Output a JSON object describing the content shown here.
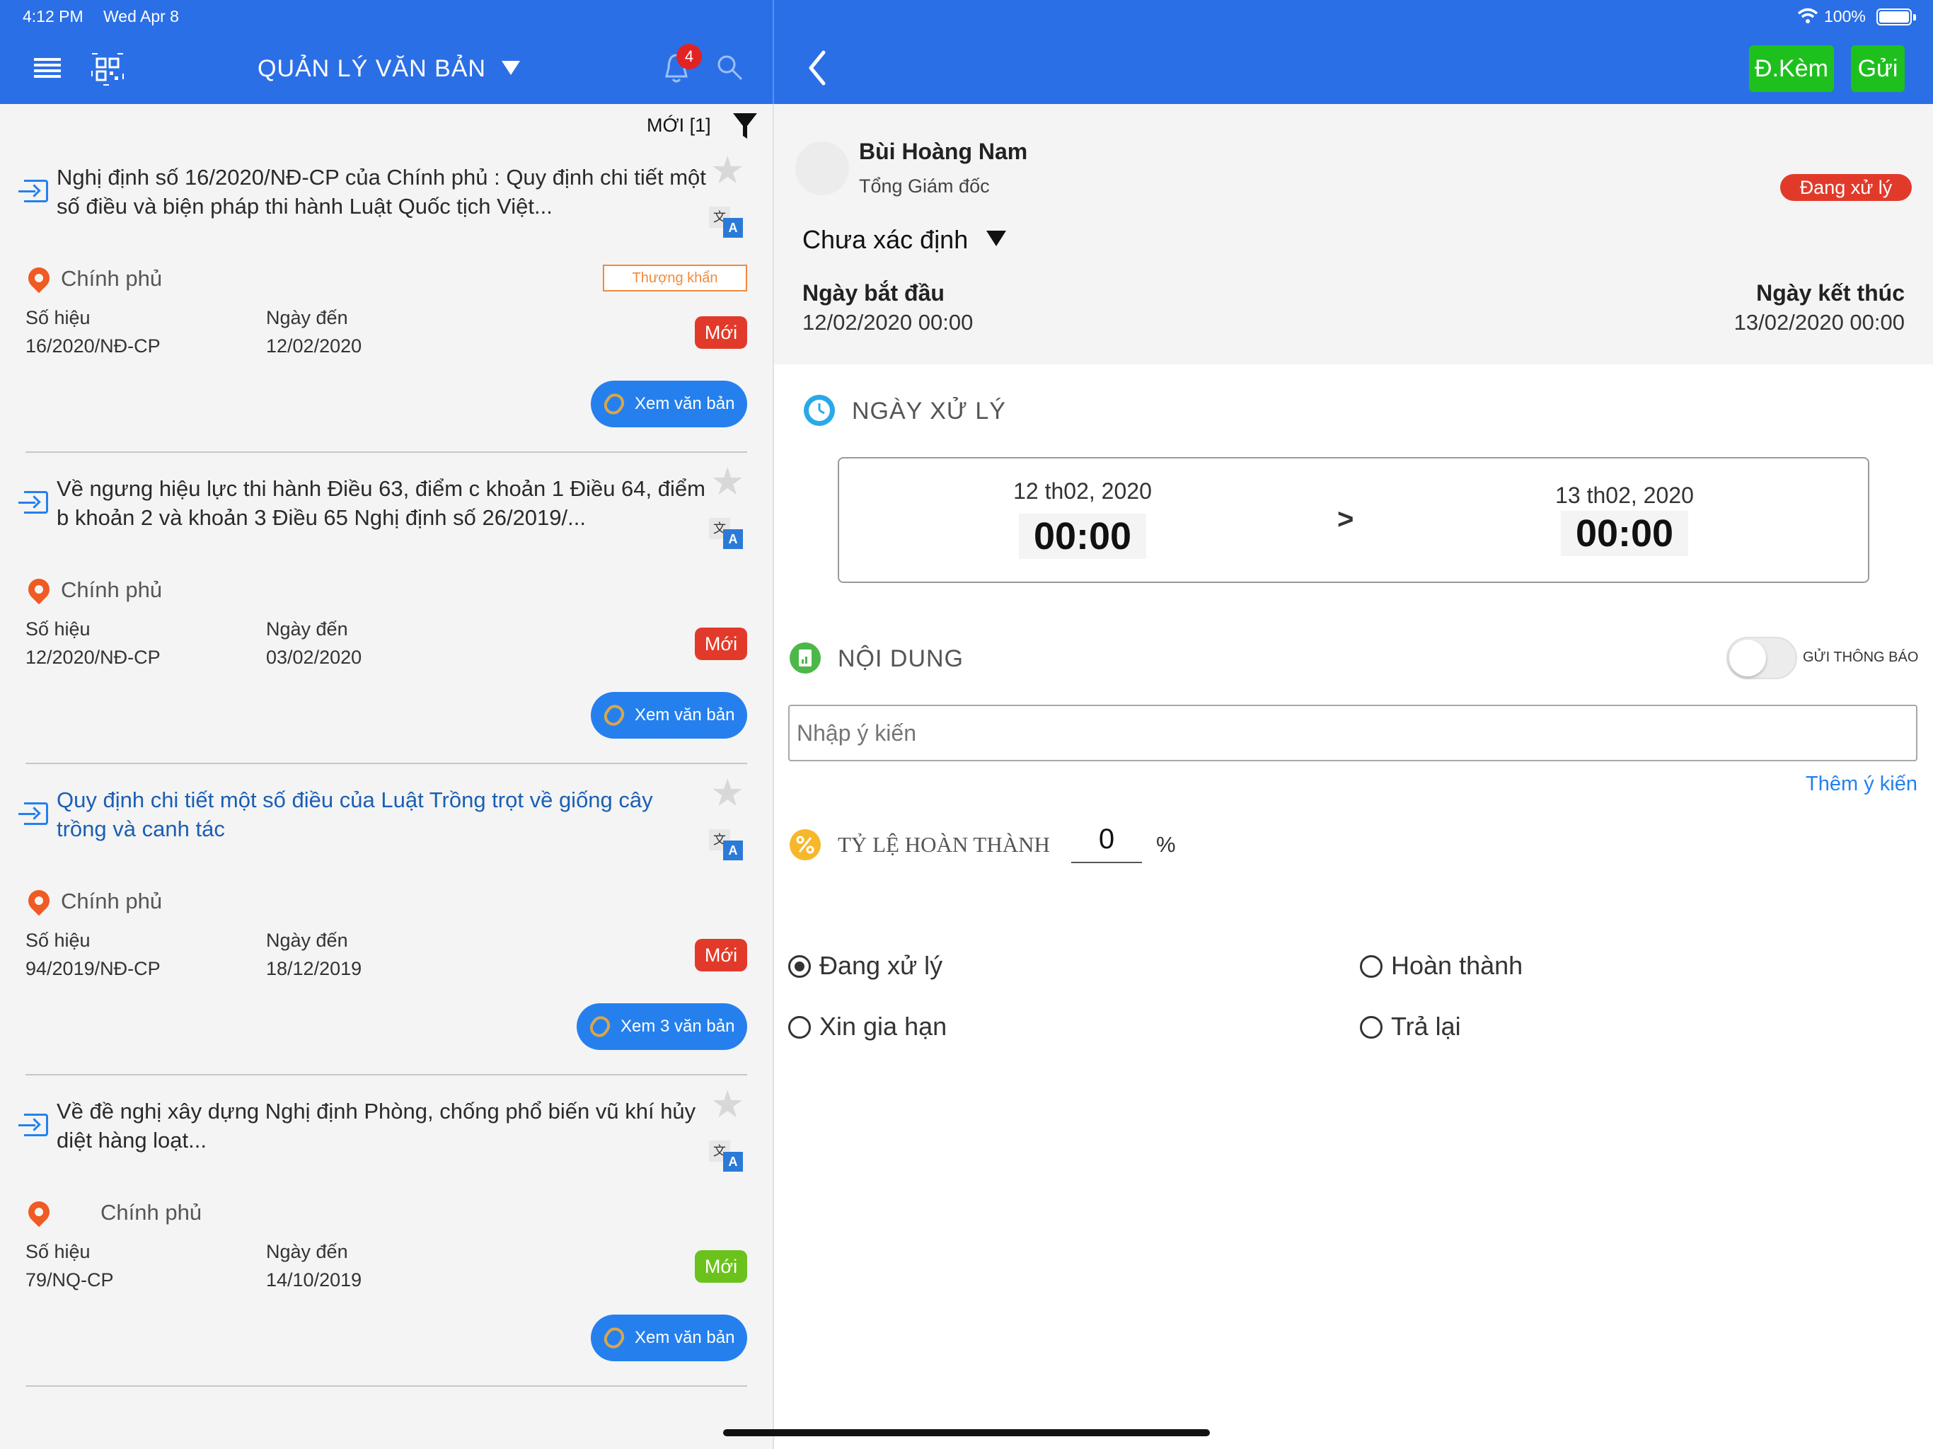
{
  "status_bar": {
    "time": "4:12 PM",
    "date": "Wed Apr 8",
    "battery": "100%"
  },
  "header": {
    "title": "QUẢN LÝ VĂN BẢN",
    "notification_count": "4"
  },
  "filter": {
    "label": "MỚI [1]"
  },
  "documents": [
    {
      "title": "Nghị định số 16/2020/NĐ-CP của Chính phủ : Quy định chi tiết một số điều và biện pháp thi hành Luật Quốc tịch Việt...",
      "agency": "Chính phủ",
      "priority": "Thượng khẩn",
      "so_hieu_label": "Số hiệu",
      "so_hieu": "16/2020/NĐ-CP",
      "ngay_den_label": "Ngày đến",
      "ngay_den": "12/02/2020",
      "status": "Mới",
      "status_color": "#e23a2a",
      "view_label": "Xem văn bản"
    },
    {
      "title": "Về ngưng hiệu lực thi hành Điều 63, điểm c khoản 1 Điều 64, điểm b khoản 2 và khoản 3 Điều 65 Nghị định số 26/2019/...",
      "agency": "Chính phủ",
      "so_hieu_label": "Số hiệu",
      "so_hieu": "12/2020/NĐ-CP",
      "ngay_den_label": "Ngày đến",
      "ngay_den": "03/02/2020",
      "status": "Mới",
      "status_color": "#e23a2a",
      "view_label": "Xem văn bản"
    },
    {
      "title": "Quy định chi tiết một số điều của Luật Trồng trọt về giống cây trồng và canh tác",
      "agency": "Chính phủ",
      "so_hieu_label": "Số hiệu",
      "so_hieu": "94/2019/NĐ-CP",
      "ngay_den_label": "Ngày đến",
      "ngay_den": "18/12/2019",
      "status": "Mới",
      "status_color": "#e23a2a",
      "view_label": "Xem 3 văn bản"
    },
    {
      "title": "Về đề nghị xây dựng Nghị định Phòng, chống phổ biến vũ khí hủy diệt hàng loạt...",
      "agency": "Chính phủ",
      "so_hieu_label": "Số hiệu",
      "so_hieu": "79/NQ-CP",
      "ngay_den_label": "Ngày đến",
      "ngay_den": "14/10/2019",
      "status": "Mới",
      "status_color": "#6cc21c",
      "view_label": "Xem văn bản"
    }
  ],
  "right_header": {
    "attach_label": "Đ.Kèm",
    "send_label": "Gửi"
  },
  "assignee": {
    "name": "Bùi Hoàng Nam",
    "role": "Tổng Giám đốc",
    "status": "Đang xử lý"
  },
  "category": {
    "selected": "Chưa xác định"
  },
  "dates": {
    "start_label": "Ngày bắt đầu",
    "start_value": "12/02/2020 00:00",
    "end_label": "Ngày kết thúc",
    "end_value": "13/02/2020 00:00"
  },
  "processing": {
    "title": "NGÀY XỬ LÝ",
    "from_date": "12 th02, 2020",
    "from_time": "00:00",
    "arrow": ">",
    "to_date": "13 th02, 2020",
    "to_time": "00:00"
  },
  "content": {
    "title": "NỘI DUNG",
    "notify_label": "GỬI THÔNG BÁO",
    "notify_on": false,
    "placeholder": "Nhập ý kiến",
    "add_label": "Thêm ý kiến"
  },
  "completion": {
    "label": "TỶ LỆ HOÀN THÀNH",
    "value": "0",
    "unit": "%"
  },
  "status_options": [
    {
      "label": "Đang xử lý",
      "selected": true
    },
    {
      "label": "Hoàn thành",
      "selected": false
    },
    {
      "label": "Xin gia hạn",
      "selected": false
    },
    {
      "label": "Trả lại",
      "selected": false
    }
  ]
}
